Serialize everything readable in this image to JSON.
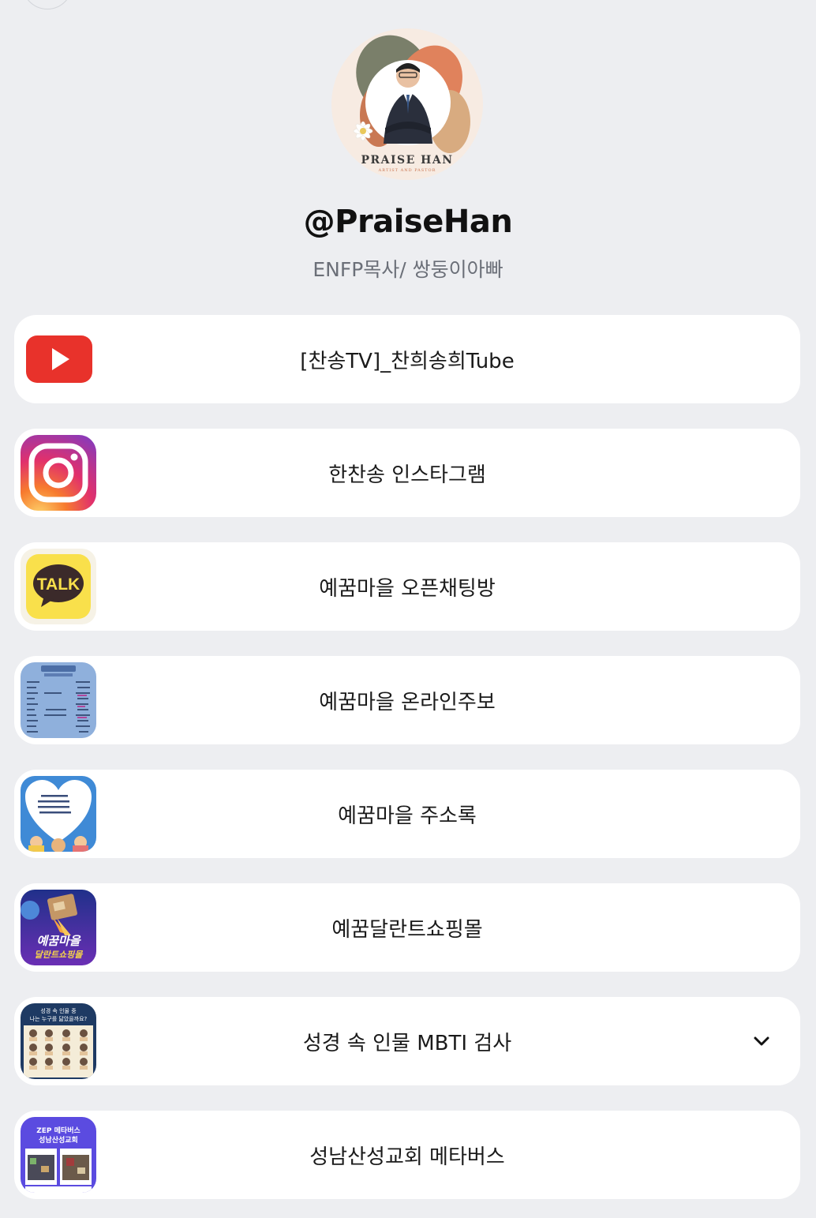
{
  "profile": {
    "handle": "@PraiseHan",
    "bio": "ENFP목사/ 쌍둥이아빠",
    "logo_text": "PRAISE HAN",
    "logo_subtext": "ARTIST AND PASTOR"
  },
  "links": [
    {
      "label": "[찬송TV]_찬희송희Tube",
      "icon": "youtube-icon"
    },
    {
      "label": "한찬송 인스타그램",
      "icon": "instagram-icon"
    },
    {
      "label": "예꿈마을 오픈채팅방",
      "icon": "kakaotalk-icon",
      "icon_text": "TALK"
    },
    {
      "label": "예꿈마을 온라인주보",
      "icon": "bulletin-thumbnail"
    },
    {
      "label": "예꿈마을 주소록",
      "icon": "address-book-thumbnail"
    },
    {
      "label": "예꿈달란트쇼핑몰",
      "icon": "talent-shop-thumbnail",
      "icon_text": "예꿈마을",
      "icon_text_2": "달란트쇼핑몰"
    },
    {
      "label": "성경 속 인물 MBTI 검사",
      "icon": "mbti-thumbnail",
      "icon_text": "성경 속 인물 중",
      "icon_text_2": "나는 누구를 닮았을까요?",
      "has_dropdown": true
    },
    {
      "label": "성남산성교회 메타버스",
      "icon": "metaverse-thumbnail",
      "icon_text": "ZEP 메타버스",
      "icon_text_2": "성남산성교회"
    }
  ],
  "colors": {
    "background": "#edeef1",
    "card": "#ffffff",
    "youtube": "#e8322b",
    "kakao": "#f9e04b"
  }
}
